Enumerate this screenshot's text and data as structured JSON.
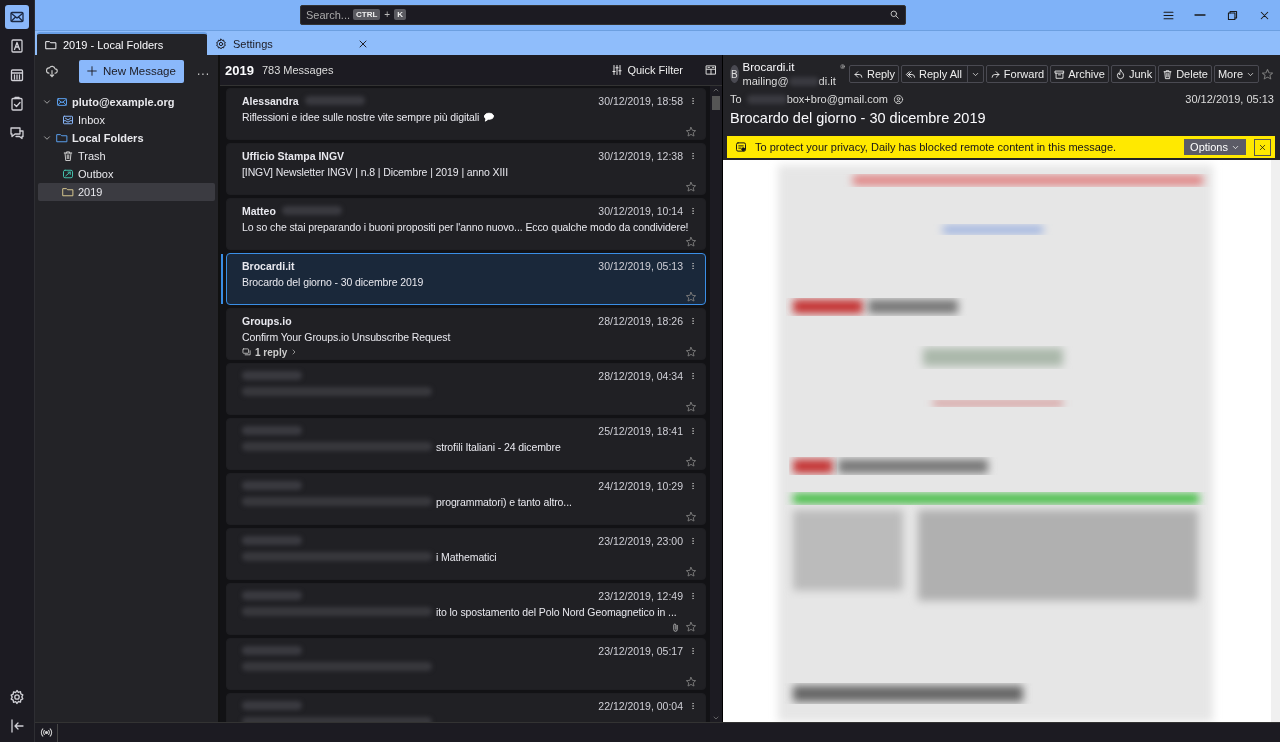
{
  "spaces": [
    {
      "selected": true
    },
    {
      "selected": false
    },
    {
      "selected": false
    },
    {
      "selected": false
    },
    {
      "selected": false
    }
  ],
  "search": {
    "placeholder": "Search...",
    "shortcut": [
      "CTRL",
      "+",
      "K"
    ]
  },
  "tabs": [
    {
      "label": "2019 - Local Folders",
      "selected": true,
      "closable": false
    },
    {
      "label": "Settings",
      "selected": false,
      "closable": true
    }
  ],
  "folder_pane": {
    "new_message": "New Message",
    "more": "...",
    "tree": [
      {
        "label": "pluto@example.org",
        "kind": "account",
        "expanded": true,
        "selected": false,
        "children": [
          {
            "label": "Inbox",
            "kind": "inbox",
            "selected": false
          }
        ]
      },
      {
        "label": "Local Folders",
        "kind": "local",
        "expanded": true,
        "selected": false,
        "children": [
          {
            "label": "Trash",
            "kind": "trash",
            "selected": false
          },
          {
            "label": "Outbox",
            "kind": "outbox",
            "selected": false
          },
          {
            "label": "2019",
            "kind": "folder",
            "selected": true
          }
        ]
      }
    ]
  },
  "message_list": {
    "folder": "2019",
    "count": "783 Messages",
    "quick_filter": "Quick Filter",
    "messages": [
      {
        "sender": "Alessandra",
        "sender_tail_redacted": true,
        "redacted": false,
        "date": "30/12/2019, 18:58",
        "subject": "Riflessioni e idee sulle nostre vite sempre più digitali",
        "speech_bubble": true,
        "selected": false
      },
      {
        "sender": "Ufficio Stampa INGV",
        "redacted": false,
        "date": "30/12/2019, 12:38",
        "subject": "[INGV] Newsletter INGV | n.8 | Dicembre | 2019 | anno XIII",
        "selected": false
      },
      {
        "sender": "Matteo",
        "sender_tail_redacted": true,
        "redacted": false,
        "date": "30/12/2019, 10:14",
        "subject": "Lo so che stai preparando i buoni propositi per l'anno nuovo... Ecco qualche modo da condividere!",
        "selected": false
      },
      {
        "sender": "Brocardi.it",
        "redacted": false,
        "date": "30/12/2019, 05:13",
        "subject": "Brocardo del giorno - 30 dicembre 2019",
        "selected": true
      },
      {
        "sender": "Groups.io",
        "redacted": false,
        "date": "28/12/2019, 18:26",
        "subject": "Confirm Your Groups.io Unsubscribe Request",
        "thread": "1 reply",
        "selected": false
      },
      {
        "redacted": true,
        "date": "28/12/2019, 04:34",
        "selected": false
      },
      {
        "redacted": true,
        "date": "25/12/2019, 18:41",
        "subject": "strofili Italiani - 24 dicembre",
        "selected": false
      },
      {
        "redacted": true,
        "date": "24/12/2019, 10:29",
        "subject": "programmatori) e tanto altro...",
        "selected": false
      },
      {
        "redacted": true,
        "date": "23/12/2019, 23:00",
        "subject": "i Mathematici",
        "selected": false
      },
      {
        "redacted": true,
        "date": "23/12/2019, 12:49",
        "subject": "ito lo spostamento del Polo Nord Geomagnetico in ...",
        "attachment": true,
        "selected": false
      },
      {
        "redacted": true,
        "date": "23/12/2019, 05:17",
        "selected": false
      },
      {
        "redacted": true,
        "date": "22/12/2019, 00:04",
        "selected": false
      }
    ]
  },
  "message": {
    "avatar": "B",
    "sender_name": "Brocardi.it",
    "sender_address_start": "mailing@",
    "sender_address_end": "di.it",
    "to_label": "To",
    "recipient": "box+bro@gmail.com",
    "date": "30/12/2019, 05:13",
    "subject": "Brocardo del giorno - 30 dicembre 2019",
    "actions": [
      {
        "label": "Reply",
        "dropdown": false
      },
      {
        "label": "Reply All",
        "dropdown": true
      },
      {
        "label": "Forward",
        "dropdown": false
      },
      {
        "label": "Archive",
        "dropdown": false
      },
      {
        "label": "Junk",
        "dropdown": false
      },
      {
        "label": "Delete",
        "dropdown": false
      },
      {
        "label": "More",
        "dropdown": false,
        "menu": true
      }
    ]
  },
  "notification": {
    "text": "To protect your privacy, Daily has blocked remote content in this message.",
    "options": "Options"
  }
}
